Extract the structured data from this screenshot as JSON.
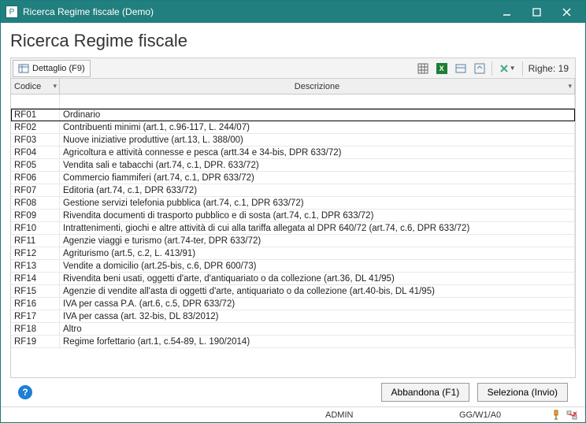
{
  "titlebar": {
    "text": "Ricerca Regime fiscale  (Demo)"
  },
  "page_title": "Ricerca Regime fiscale",
  "toolbar": {
    "dettaglio": "Dettaglio (F9)",
    "righe_label": "Righe:",
    "righe_count": "19"
  },
  "grid": {
    "headers": {
      "codice": "Codice",
      "descrizione": "Descrizione"
    },
    "rows": [
      {
        "code": "RF01",
        "desc": "Ordinario"
      },
      {
        "code": "RF02",
        "desc": "Contribuenti minimi (art.1, c.96-117, L. 244/07)"
      },
      {
        "code": "RF03",
        "desc": "Nuove iniziative produttive (art.13, L. 388/00)"
      },
      {
        "code": "RF04",
        "desc": "Agricoltura e attività connesse e pesca (artt.34 e 34-bis, DPR 633/72)"
      },
      {
        "code": "RF05",
        "desc": "Vendita sali e tabacchi (art.74, c.1, DPR. 633/72)"
      },
      {
        "code": "RF06",
        "desc": "Commercio fiammiferi (art.74, c.1, DPR  633/72)"
      },
      {
        "code": "RF07",
        "desc": "Editoria (art.74, c.1, DPR  633/72)"
      },
      {
        "code": "RF08",
        "desc": "Gestione servizi telefonia pubblica (art.74, c.1, DPR 633/72)"
      },
      {
        "code": "RF09",
        "desc": "Rivendita documenti di trasporto pubblico e di sosta (art.74, c.1, DPR  633/72)"
      },
      {
        "code": "RF10",
        "desc": "Intrattenimenti, giochi e altre attività di cui alla tariffa allegata al DPR 640/72 (art.74, c.6, DPR 633/72)"
      },
      {
        "code": "RF11",
        "desc": "Agenzie viaggi e turismo (art.74-ter, DPR 633/72)"
      },
      {
        "code": "RF12",
        "desc": "Agriturismo (art.5, c.2, L. 413/91)"
      },
      {
        "code": "RF13",
        "desc": "Vendite a domicilio (art.25-bis, c.6, DPR  600/73)"
      },
      {
        "code": "RF14",
        "desc": "Rivendita beni usati, oggetti d'arte, d'antiquariato o da collezione (art.36, DL 41/95)"
      },
      {
        "code": "RF15",
        "desc": "Agenzie di vendite all'asta di oggetti d'arte, antiquariato o da collezione (art.40-bis, DL 41/95)"
      },
      {
        "code": "RF16",
        "desc": "IVA per cassa P.A. (art.6, c.5, DPR 633/72)"
      },
      {
        "code": "RF17",
        "desc": "IVA per cassa (art. 32-bis, DL 83/2012)"
      },
      {
        "code": "RF18",
        "desc": "Altro"
      },
      {
        "code": "RF19",
        "desc": "Regime forfettario (art.1, c.54-89, L. 190/2014)"
      }
    ]
  },
  "buttons": {
    "abbandona": "Abbandona (F1)",
    "seleziona": "Seleziona (Invio)"
  },
  "statusbar": {
    "user": "ADMIN",
    "session": "GG/W1/A0"
  }
}
